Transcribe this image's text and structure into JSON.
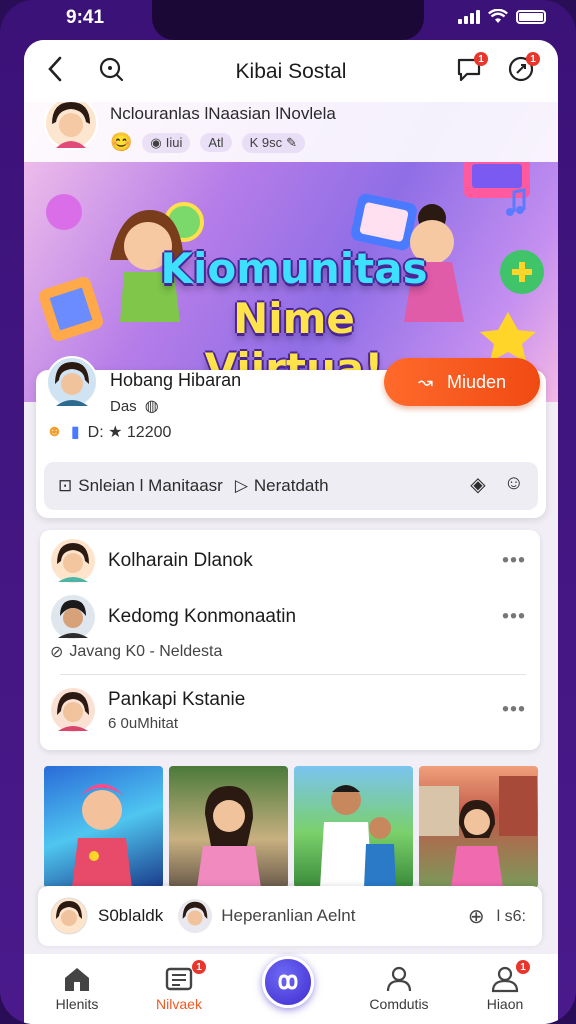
{
  "status": {
    "time": "9:41"
  },
  "header": {
    "title": "Kibai Sostal"
  },
  "banner": {
    "author": "Nclouranlas lNaasian lNovlela",
    "chip1": "Iiui",
    "chip2": "Atl",
    "chip3": "K 9sc",
    "title_line1": "Kiomunitas",
    "title_line2": "Nime Viirtua!"
  },
  "profile": {
    "name": "Hobang Hibaran",
    "sub": "Das",
    "stats": "D: ★ 12200",
    "join_label": "Miuden"
  },
  "actions": {
    "item1": "Snleian l Manitaasr",
    "item2": "Neratdath"
  },
  "list": {
    "items": [
      {
        "title": "Kolharain Dlanok"
      },
      {
        "title": "Kedomg Konmonaatin"
      },
      {
        "title": "Pankapi Kstanie",
        "sub": "6 0uMhitat"
      }
    ],
    "meta": "Javang K0 - Neldesta"
  },
  "comment": {
    "user": "S0blaldk",
    "text": "Heperanlian Aelnt",
    "count": "l s6:"
  },
  "tabs": [
    {
      "label": "Hlenits"
    },
    {
      "label": "Nilvaek"
    },
    {
      "label": "Comdutis"
    },
    {
      "label": "Hiaon"
    }
  ],
  "colors": {
    "accent": "#f05a22",
    "purple": "#4a1a8c",
    "badge": "#e8362c"
  },
  "icons": {
    "back": "chevron-left-icon",
    "search": "search-icon",
    "chat": "chat-bubble-icon",
    "notify": "notification-icon",
    "home": "home-icon",
    "message": "message-icon",
    "community": "community-icon",
    "profile": "profile-icon"
  }
}
